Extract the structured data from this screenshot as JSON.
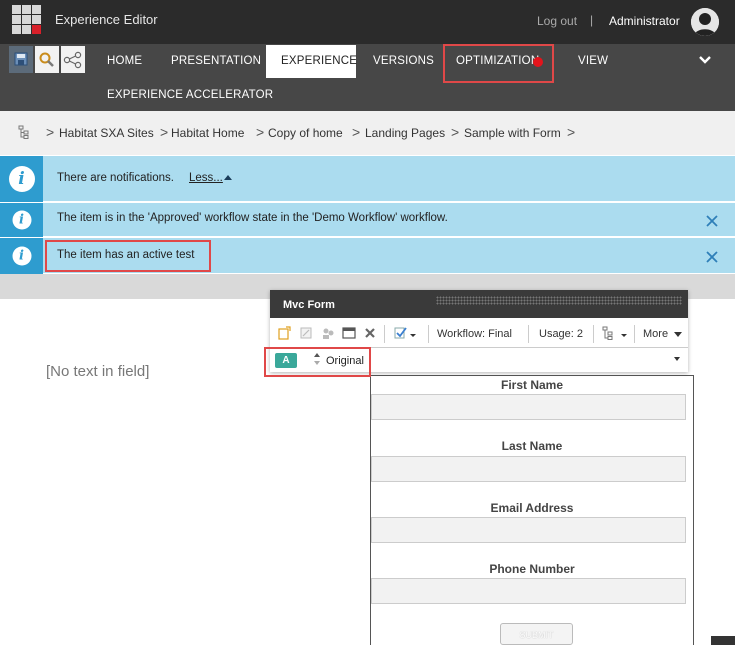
{
  "header": {
    "app_title": "Experience Editor",
    "logout_label": "Log out",
    "separator": "|",
    "user_name": "Administrator"
  },
  "ribbon": {
    "tabs": [
      {
        "label": "HOME"
      },
      {
        "label": "PRESENTATION"
      },
      {
        "label": "EXPERIENCE",
        "selected": true
      },
      {
        "label": "VERSIONS"
      },
      {
        "label": "OPTIMIZATION",
        "has_alert_dot": true
      },
      {
        "label": "VIEW"
      },
      {
        "label": "EXPERIENCE ACCELERATOR"
      }
    ],
    "quick_actions": [
      "save-icon",
      "search-icon",
      "share-icon"
    ],
    "collapse_icon": "chevron-down-icon",
    "alert_dot_color": "#e3141c"
  },
  "breadcrumb": {
    "root_icon": "sitemap-icon",
    "separator": ">",
    "items": [
      "Habitat SXA Sites",
      "Habitat Home",
      "Copy of home",
      "Landing Pages",
      "Sample with Form"
    ]
  },
  "notifications": {
    "summary": "There are notifications.",
    "less_label": "Less...",
    "items": [
      {
        "text": "The item is in the 'Approved' workflow state in the 'Demo Workflow' workflow."
      },
      {
        "text": "The item has an active test"
      }
    ],
    "info_color": "#2e9ccf",
    "background": "#abdcef"
  },
  "page": {
    "empty_field_text": "[No text in field]"
  },
  "chrome": {
    "title": "Mvc Form",
    "workflow_label": "Workflow: Final",
    "usage_label": "Usage: 2",
    "more_label": "More",
    "variant_badge": "A",
    "variant_label": "Original"
  },
  "form": {
    "fields": [
      {
        "label": "First Name",
        "value": ""
      },
      {
        "label": "Last Name",
        "value": ""
      },
      {
        "label": "Email Address",
        "value": ""
      },
      {
        "label": "Phone Number",
        "value": ""
      }
    ],
    "submit_label": "SUBMIT"
  },
  "colors": {
    "topbar": "#2b2b2b",
    "ribbon": "#474747",
    "highlight_red": "#e04848",
    "variant_badge": "#3aa89a"
  }
}
